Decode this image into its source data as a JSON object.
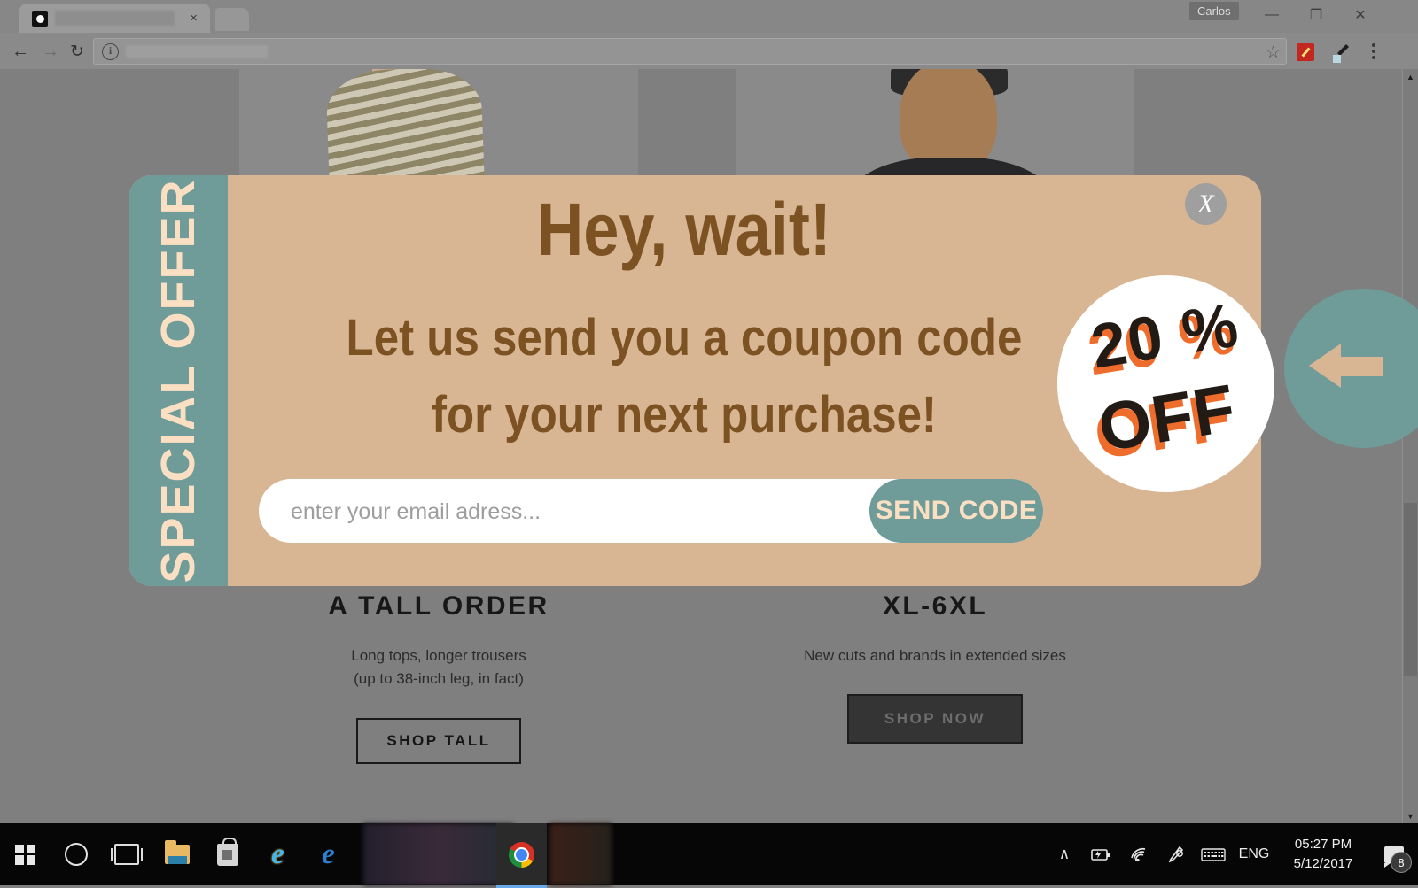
{
  "browser": {
    "tab": {
      "title": "",
      "close_label": "×"
    },
    "profile": "Carlos",
    "window_controls": {
      "minimize": "—",
      "maximize": "❐",
      "close": "✕"
    },
    "nav": {
      "back": "←",
      "forward": "→",
      "reload": "↻"
    },
    "address": {
      "value": "",
      "info_icon": "i"
    },
    "bookmark_star": "☆",
    "menu_dots": "⋮"
  },
  "modal": {
    "side_label": "SPECIAL OFFER",
    "headline": "Hey, wait!",
    "subline_1": "Let us send you a coupon code",
    "subline_2": "for your next purchase!",
    "email_placeholder": "enter your email adress...",
    "email_value": "",
    "send_button": "SEND CODE",
    "badge_top": "20 %",
    "badge_bottom": "OFF",
    "close_label": "X",
    "colors": {
      "background": "#d9b693",
      "sidebar": "#6f9c99",
      "text": "#7c5223",
      "cream": "#fbdfc3",
      "accent_orange": "#ef6d2c",
      "badge_dark": "#221a14"
    }
  },
  "page": {
    "columns": [
      {
        "title": "A TALL ORDER",
        "sub_1": "Long tops, longer trousers",
        "sub_2": "(up to 38-inch leg, in fact)",
        "cta": "SHOP TALL"
      },
      {
        "title": "XL-6XL",
        "sub_1": "New cuts and brands in extended sizes",
        "sub_2": "",
        "cta": "SHOP NOW"
      }
    ],
    "scrollbar": {
      "up": "▲",
      "down": "▼"
    }
  },
  "taskbar": {
    "language": "ENG",
    "time": "05:27 PM",
    "date": "5/12/2017",
    "notification_count": "8",
    "tray_overflow": "∧",
    "icons": [
      "start-icon",
      "cortana-icon",
      "task-view-icon",
      "file-explorer-icon",
      "store-icon",
      "internet-explorer-icon",
      "edge-icon",
      "chrome-icon"
    ]
  }
}
